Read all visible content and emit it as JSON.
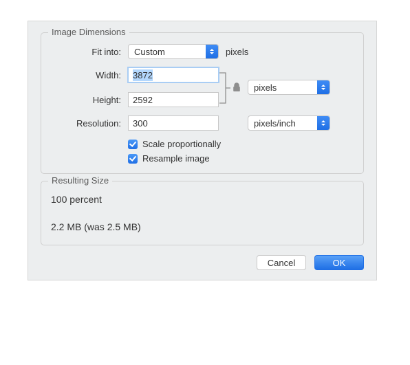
{
  "groups": {
    "image_dimensions_title": "Image Dimensions",
    "resulting_size_title": "Resulting Size"
  },
  "labels": {
    "fit_into": "Fit into:",
    "width": "Width:",
    "height": "Height:",
    "resolution": "Resolution:"
  },
  "fields": {
    "fit_into_value": "Custom",
    "fit_into_unit": "pixels",
    "width_value": "3872",
    "height_value": "2592",
    "wh_unit": "pixels",
    "resolution_value": "300",
    "resolution_unit": "pixels/inch"
  },
  "checkboxes": {
    "scale_proportionally": "Scale proportionally",
    "resample_image": "Resample image"
  },
  "result": {
    "percent_line": "100 percent",
    "size_line": "2.2 MB (was 2.5 MB)"
  },
  "buttons": {
    "cancel": "Cancel",
    "ok": "OK"
  }
}
